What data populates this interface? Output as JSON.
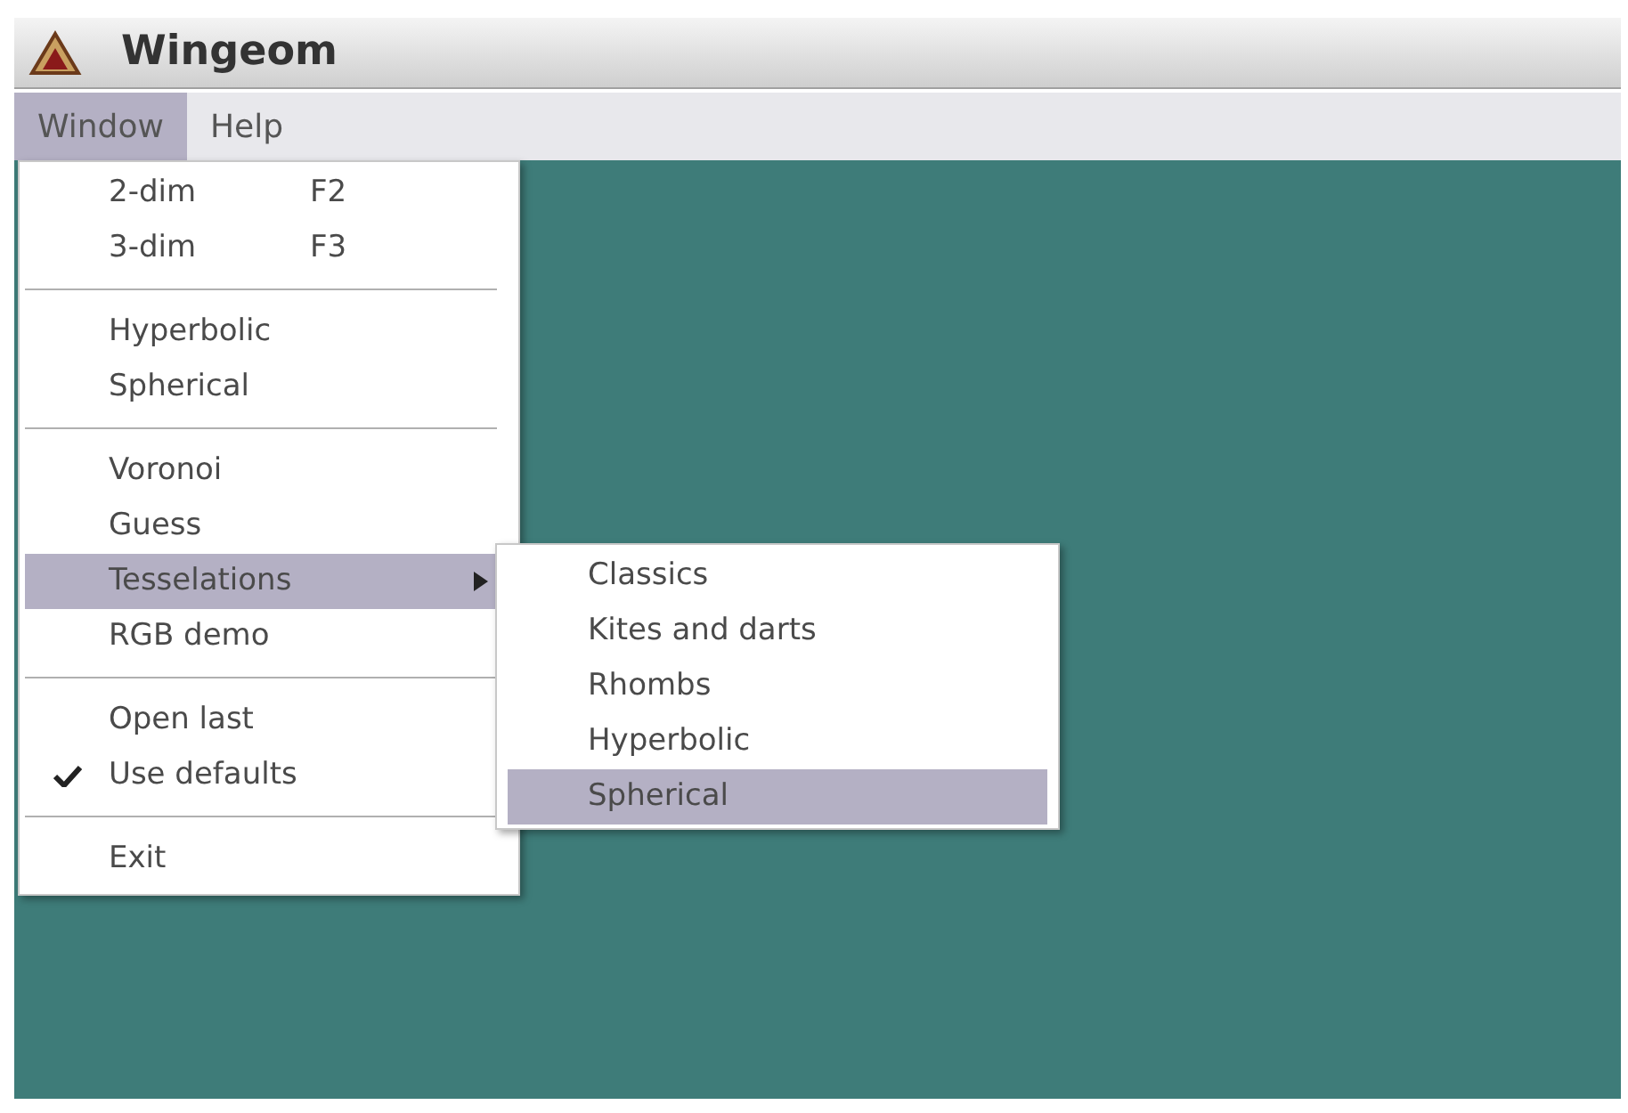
{
  "window": {
    "title": "Wingeom"
  },
  "menubar": [
    {
      "label": "Window",
      "selected": true
    },
    {
      "label": "Help",
      "selected": false
    }
  ],
  "menu": [
    {
      "kind": "item",
      "label": "2-dim",
      "shortcut": "F2",
      "selected": false
    },
    {
      "kind": "item",
      "label": "3-dim",
      "shortcut": "F3",
      "selected": false
    },
    {
      "kind": "separator"
    },
    {
      "kind": "item",
      "label": "Hyperbolic",
      "selected": false
    },
    {
      "kind": "item",
      "label": "Spherical",
      "selected": false
    },
    {
      "kind": "separator"
    },
    {
      "kind": "item",
      "label": "Voronoi",
      "selected": false
    },
    {
      "kind": "item",
      "label": "Guess",
      "selected": false
    },
    {
      "kind": "item",
      "label": "Tesselations",
      "selected": true,
      "expanded": true,
      "submenu": [
        {
          "label": "Classics",
          "selected": false
        },
        {
          "label": "Kites and darts",
          "selected": false
        },
        {
          "label": "Rhombs",
          "selected": false
        },
        {
          "label": "Hyperbolic",
          "selected": false
        },
        {
          "label": "Spherical",
          "selected": true
        }
      ]
    },
    {
      "kind": "item",
      "label": "RGB demo",
      "selected": false
    },
    {
      "kind": "separator"
    },
    {
      "kind": "item",
      "label": "Open last",
      "selected": false
    },
    {
      "kind": "item",
      "label": "Use defaults",
      "selected": false,
      "checked": true
    },
    {
      "kind": "separator"
    },
    {
      "kind": "item",
      "label": "Exit",
      "selected": false
    }
  ]
}
